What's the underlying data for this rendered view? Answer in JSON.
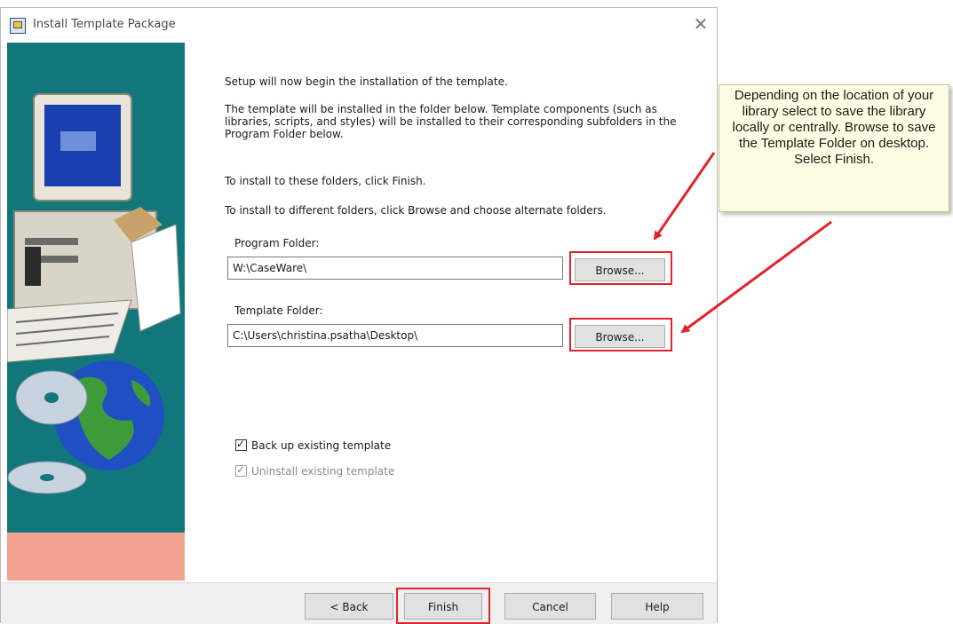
{
  "window": {
    "title": "Install Template Package",
    "close_label": "✕"
  },
  "content": {
    "intro": "Setup will now begin the installation of the template.",
    "description": "The template will be installed in the folder below.  Template components (such as libraries, scripts, and styles) will be installed to their corresponding subfolders in the Program Folder below.",
    "finish_hint": "To install to these folders, click Finish.",
    "browse_hint": "To install to different folders, click Browse and choose alternate folders."
  },
  "program_folder": {
    "label": "Program Folder:",
    "value": "W:\\CaseWare\\",
    "browse_label": "Browse..."
  },
  "template_folder": {
    "label": "Template Folder:",
    "value": "C:\\Users\\christina.psatha\\Desktop\\",
    "browse_label": "Browse..."
  },
  "options": {
    "backup": {
      "label": "Back up existing template",
      "checked": true
    },
    "uninstall": {
      "label": "Uninstall existing template",
      "checked": true,
      "disabled": true
    }
  },
  "footer": {
    "back_label": "< Back",
    "finish_label": "Finish",
    "cancel_label": "Cancel",
    "help_label": "Help"
  },
  "callout": {
    "text": "Depending on the location of your library select to save the library locally or centrally. Browse to save the Template Folder on desktop. Select Finish."
  },
  "colors": {
    "panel_teal": "#12777a",
    "panel_salmon": "#f4a290",
    "highlight_red": "#e0242a",
    "callout_bg": "#fdfde3"
  }
}
